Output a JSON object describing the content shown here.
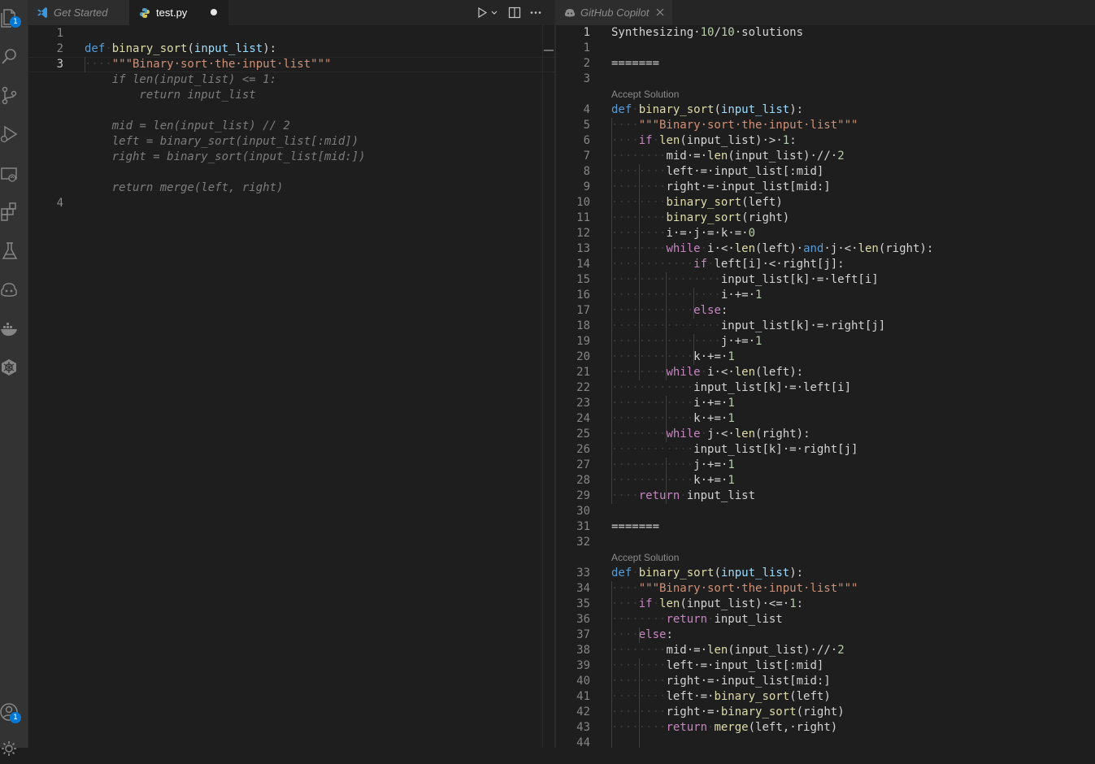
{
  "activity_bar": {
    "items": [
      {
        "name": "explorer-icon",
        "badge": "1"
      },
      {
        "name": "search-icon"
      },
      {
        "name": "source-control-icon"
      },
      {
        "name": "run-debug-icon"
      },
      {
        "name": "remote-explorer-icon"
      },
      {
        "name": "extensions-icon"
      },
      {
        "name": "testing-icon"
      },
      {
        "name": "copilot-icon"
      },
      {
        "name": "docker-icon"
      },
      {
        "name": "kubernetes-icon"
      }
    ],
    "bottom": [
      {
        "name": "accounts-icon",
        "badge": "1"
      },
      {
        "name": "settings-gear-icon"
      }
    ]
  },
  "left_editor": {
    "tabs": [
      {
        "label": "Get Started",
        "icon": "vscode-logo-icon",
        "active": false
      },
      {
        "label": "test.py",
        "icon": "python-icon",
        "active": true,
        "dirty": true
      }
    ],
    "actions": [
      "run-icon",
      "chevron-down-icon",
      "split-editor-icon",
      "more-icon"
    ],
    "lines": [
      {
        "n": "1",
        "tokens": []
      },
      {
        "n": "2",
        "tokens": [
          [
            "kw",
            "def"
          ],
          [
            "ws",
            "·"
          ],
          [
            "fn",
            "binary_sort"
          ],
          [
            "op",
            "("
          ],
          [
            "param",
            "input_list"
          ],
          [
            "op",
            "):"
          ]
        ]
      },
      {
        "n": "3",
        "active": true,
        "tokens": [
          [
            "ws",
            "····"
          ],
          [
            "str",
            "\"\"\"Binary·sort·the·input·list\"\"\""
          ]
        ]
      },
      {
        "n": "",
        "tokens": [
          [
            "ghost",
            "    if len(input_list) <= 1:"
          ]
        ]
      },
      {
        "n": "",
        "tokens": [
          [
            "ghost",
            "        return input_list"
          ]
        ]
      },
      {
        "n": "",
        "tokens": []
      },
      {
        "n": "",
        "tokens": [
          [
            "ghost",
            "    mid = len(input_list) // 2"
          ]
        ]
      },
      {
        "n": "",
        "tokens": [
          [
            "ghost",
            "    left = binary_sort(input_list[:mid])"
          ]
        ]
      },
      {
        "n": "",
        "tokens": [
          [
            "ghost",
            "    right = binary_sort(input_list[mid:])"
          ]
        ]
      },
      {
        "n": "",
        "tokens": []
      },
      {
        "n": "",
        "tokens": [
          [
            "ghost",
            "    return merge(left, right)"
          ]
        ]
      },
      {
        "n": "4",
        "tokens": []
      }
    ]
  },
  "right_editor": {
    "tabs": [
      {
        "label": "GitHub Copilot",
        "icon": "copilot-icon",
        "active": true
      }
    ],
    "accept_label": "Accept Solution",
    "lines": [
      {
        "n": "1",
        "active": true,
        "tokens": [
          [
            "txt",
            "Synthesizing·"
          ],
          [
            "num",
            "10"
          ],
          [
            "txt",
            "/"
          ],
          [
            "num",
            "10"
          ],
          [
            "txt",
            "·solutions"
          ]
        ]
      },
      {
        "n": "1",
        "tokens": []
      },
      {
        "n": "2",
        "tokens": [
          [
            "txt",
            "======="
          ]
        ]
      },
      {
        "n": "3",
        "tokens": []
      },
      {
        "label": "Accept Solution"
      },
      {
        "n": "4",
        "tokens": [
          [
            "kw",
            "def"
          ],
          [
            "ws",
            "·"
          ],
          [
            "fn",
            "binary_sort"
          ],
          [
            "op",
            "("
          ],
          [
            "param",
            "input_list"
          ],
          [
            "op",
            "):"
          ]
        ]
      },
      {
        "n": "5",
        "tokens": [
          [
            "ws",
            "····"
          ],
          [
            "str",
            "\"\"\"Binary·sort·the·input·list\"\"\""
          ]
        ]
      },
      {
        "n": "6",
        "tokens": [
          [
            "ws",
            "····"
          ],
          [
            "kwc",
            "if"
          ],
          [
            "ws",
            "·"
          ],
          [
            "fn",
            "len"
          ],
          [
            "op",
            "("
          ],
          [
            "txt",
            "input_list"
          ],
          [
            "op",
            ")·>·"
          ],
          [
            "num",
            "1"
          ],
          [
            "op",
            ":"
          ]
        ]
      },
      {
        "n": "7",
        "tokens": [
          [
            "ws",
            "········"
          ],
          [
            "txt",
            "mid·=·"
          ],
          [
            "fn",
            "len"
          ],
          [
            "op",
            "("
          ],
          [
            "txt",
            "input_list"
          ],
          [
            "op",
            ")·//·"
          ],
          [
            "num",
            "2"
          ]
        ]
      },
      {
        "n": "8",
        "tokens": [
          [
            "ws",
            "········"
          ],
          [
            "txt",
            "left·=·input_list[:mid]"
          ]
        ]
      },
      {
        "n": "9",
        "tokens": [
          [
            "ws",
            "········"
          ],
          [
            "txt",
            "right·=·input_list[mid:]"
          ]
        ]
      },
      {
        "n": "10",
        "tokens": [
          [
            "ws",
            "········"
          ],
          [
            "fn",
            "binary_sort"
          ],
          [
            "op",
            "("
          ],
          [
            "txt",
            "left"
          ],
          [
            "op",
            ")"
          ]
        ]
      },
      {
        "n": "11",
        "tokens": [
          [
            "ws",
            "········"
          ],
          [
            "fn",
            "binary_sort"
          ],
          [
            "op",
            "("
          ],
          [
            "txt",
            "right"
          ],
          [
            "op",
            ")"
          ]
        ]
      },
      {
        "n": "12",
        "tokens": [
          [
            "ws",
            "········"
          ],
          [
            "txt",
            "i·=·j·=·k·=·"
          ],
          [
            "num",
            "0"
          ]
        ]
      },
      {
        "n": "13",
        "tokens": [
          [
            "ws",
            "········"
          ],
          [
            "kwc",
            "while"
          ],
          [
            "ws",
            "·"
          ],
          [
            "txt",
            "i·<·"
          ],
          [
            "fn",
            "len"
          ],
          [
            "op",
            "("
          ],
          [
            "txt",
            "left"
          ],
          [
            "op",
            ")·"
          ],
          [
            "kw",
            "and"
          ],
          [
            "txt",
            "·j·<·"
          ],
          [
            "fn",
            "len"
          ],
          [
            "op",
            "("
          ],
          [
            "txt",
            "right"
          ],
          [
            "op",
            "):"
          ]
        ]
      },
      {
        "n": "14",
        "tokens": [
          [
            "ws",
            "············"
          ],
          [
            "kwc",
            "if"
          ],
          [
            "ws",
            "·"
          ],
          [
            "txt",
            "left[i]·<·right[j]:"
          ]
        ]
      },
      {
        "n": "15",
        "tokens": [
          [
            "ws",
            "················"
          ],
          [
            "txt",
            "input_list[k]·=·left[i]"
          ]
        ]
      },
      {
        "n": "16",
        "tokens": [
          [
            "ws",
            "················"
          ],
          [
            "txt",
            "i·+=·"
          ],
          [
            "num",
            "1"
          ]
        ]
      },
      {
        "n": "17",
        "tokens": [
          [
            "ws",
            "············"
          ],
          [
            "kwc",
            "else"
          ],
          [
            "op",
            ":"
          ]
        ]
      },
      {
        "n": "18",
        "tokens": [
          [
            "ws",
            "················"
          ],
          [
            "txt",
            "input_list[k]·=·right[j]"
          ]
        ]
      },
      {
        "n": "19",
        "tokens": [
          [
            "ws",
            "················"
          ],
          [
            "txt",
            "j·+=·"
          ],
          [
            "num",
            "1"
          ]
        ]
      },
      {
        "n": "20",
        "tokens": [
          [
            "ws",
            "············"
          ],
          [
            "txt",
            "k·+=·"
          ],
          [
            "num",
            "1"
          ]
        ]
      },
      {
        "n": "21",
        "tokens": [
          [
            "ws",
            "········"
          ],
          [
            "kwc",
            "while"
          ],
          [
            "ws",
            "·"
          ],
          [
            "txt",
            "i·<·"
          ],
          [
            "fn",
            "len"
          ],
          [
            "op",
            "("
          ],
          [
            "txt",
            "left"
          ],
          [
            "op",
            "):"
          ]
        ]
      },
      {
        "n": "22",
        "tokens": [
          [
            "ws",
            "············"
          ],
          [
            "txt",
            "input_list[k]·=·left[i]"
          ]
        ]
      },
      {
        "n": "23",
        "tokens": [
          [
            "ws",
            "············"
          ],
          [
            "txt",
            "i·+=·"
          ],
          [
            "num",
            "1"
          ]
        ]
      },
      {
        "n": "24",
        "tokens": [
          [
            "ws",
            "············"
          ],
          [
            "txt",
            "k·+=·"
          ],
          [
            "num",
            "1"
          ]
        ]
      },
      {
        "n": "25",
        "tokens": [
          [
            "ws",
            "········"
          ],
          [
            "kwc",
            "while"
          ],
          [
            "ws",
            "·"
          ],
          [
            "txt",
            "j·<·"
          ],
          [
            "fn",
            "len"
          ],
          [
            "op",
            "("
          ],
          [
            "txt",
            "right"
          ],
          [
            "op",
            "):"
          ]
        ]
      },
      {
        "n": "26",
        "tokens": [
          [
            "ws",
            "············"
          ],
          [
            "txt",
            "input_list[k]·=·right[j]"
          ]
        ]
      },
      {
        "n": "27",
        "tokens": [
          [
            "ws",
            "············"
          ],
          [
            "txt",
            "j·+=·"
          ],
          [
            "num",
            "1"
          ]
        ]
      },
      {
        "n": "28",
        "tokens": [
          [
            "ws",
            "············"
          ],
          [
            "txt",
            "k·+=·"
          ],
          [
            "num",
            "1"
          ]
        ]
      },
      {
        "n": "29",
        "tokens": [
          [
            "ws",
            "····"
          ],
          [
            "kwc",
            "return"
          ],
          [
            "ws",
            "·"
          ],
          [
            "txt",
            "input_list"
          ]
        ]
      },
      {
        "n": "30",
        "tokens": []
      },
      {
        "n": "31",
        "tokens": [
          [
            "txt",
            "======="
          ]
        ]
      },
      {
        "n": "32",
        "tokens": []
      },
      {
        "label": "Accept Solution"
      },
      {
        "n": "33",
        "tokens": [
          [
            "kw",
            "def"
          ],
          [
            "ws",
            "·"
          ],
          [
            "fn",
            "binary_sort"
          ],
          [
            "op",
            "("
          ],
          [
            "param",
            "input_list"
          ],
          [
            "op",
            "):"
          ]
        ]
      },
      {
        "n": "34",
        "tokens": [
          [
            "ws",
            "····"
          ],
          [
            "str",
            "\"\"\"Binary·sort·the·input·list\"\"\""
          ]
        ]
      },
      {
        "n": "35",
        "tokens": [
          [
            "ws",
            "····"
          ],
          [
            "kwc",
            "if"
          ],
          [
            "ws",
            "·"
          ],
          [
            "fn",
            "len"
          ],
          [
            "op",
            "("
          ],
          [
            "txt",
            "input_list"
          ],
          [
            "op",
            ")·<=·"
          ],
          [
            "num",
            "1"
          ],
          [
            "op",
            ":"
          ]
        ]
      },
      {
        "n": "36",
        "tokens": [
          [
            "ws",
            "········"
          ],
          [
            "kwc",
            "return"
          ],
          [
            "ws",
            "·"
          ],
          [
            "txt",
            "input_list"
          ]
        ]
      },
      {
        "n": "37",
        "tokens": [
          [
            "ws",
            "····"
          ],
          [
            "kwc",
            "else"
          ],
          [
            "op",
            ":"
          ]
        ]
      },
      {
        "n": "38",
        "tokens": [
          [
            "ws",
            "········"
          ],
          [
            "txt",
            "mid·=·"
          ],
          [
            "fn",
            "len"
          ],
          [
            "op",
            "("
          ],
          [
            "txt",
            "input_list"
          ],
          [
            "op",
            ")·//·"
          ],
          [
            "num",
            "2"
          ]
        ]
      },
      {
        "n": "39",
        "tokens": [
          [
            "ws",
            "········"
          ],
          [
            "txt",
            "left·=·input_list[:mid]"
          ]
        ]
      },
      {
        "n": "40",
        "tokens": [
          [
            "ws",
            "········"
          ],
          [
            "txt",
            "right·=·input_list[mid:]"
          ]
        ]
      },
      {
        "n": "41",
        "tokens": [
          [
            "ws",
            "········"
          ],
          [
            "txt",
            "left·=·"
          ],
          [
            "fn",
            "binary_sort"
          ],
          [
            "op",
            "("
          ],
          [
            "txt",
            "left"
          ],
          [
            "op",
            ")"
          ]
        ]
      },
      {
        "n": "42",
        "tokens": [
          [
            "ws",
            "········"
          ],
          [
            "txt",
            "right·=·"
          ],
          [
            "fn",
            "binary_sort"
          ],
          [
            "op",
            "("
          ],
          [
            "txt",
            "right"
          ],
          [
            "op",
            ")"
          ]
        ]
      },
      {
        "n": "43",
        "tokens": [
          [
            "ws",
            "········"
          ],
          [
            "kwc",
            "return"
          ],
          [
            "ws",
            "·"
          ],
          [
            "fn",
            "merge"
          ],
          [
            "op",
            "("
          ],
          [
            "txt",
            "left,·right"
          ],
          [
            "op",
            ")"
          ]
        ]
      },
      {
        "n": "44",
        "tokens": []
      }
    ]
  }
}
